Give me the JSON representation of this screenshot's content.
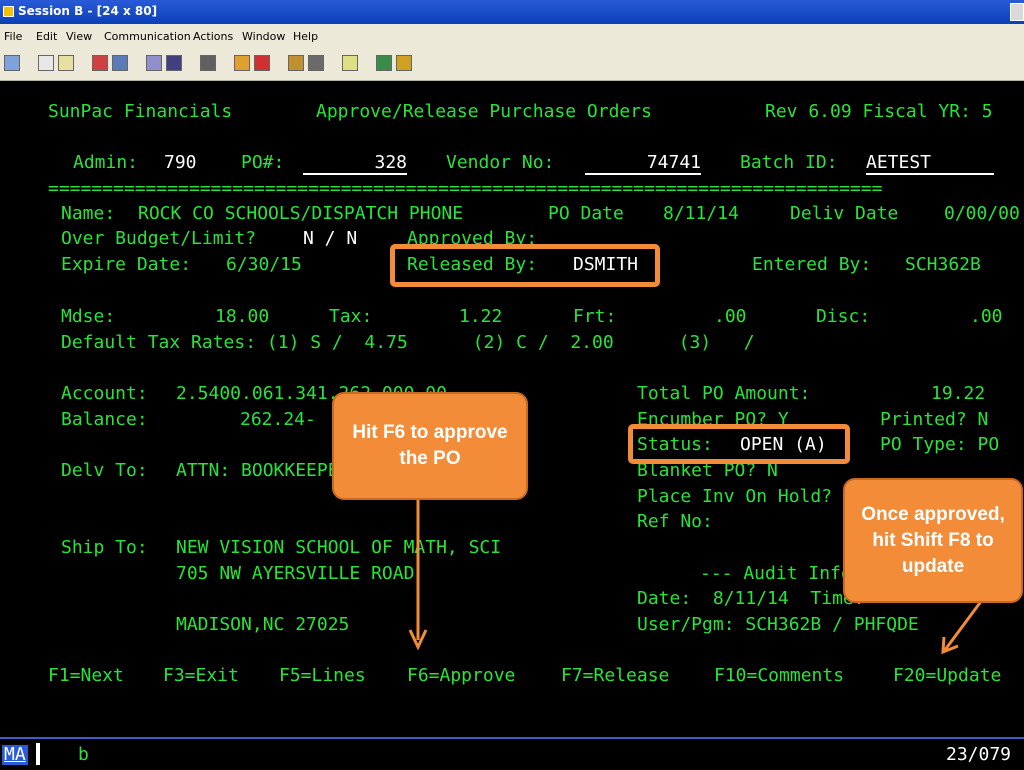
{
  "window": {
    "title": "Session B - [24 x 80]"
  },
  "menu": [
    "File",
    "Edit",
    "View",
    "Communication",
    "Actions",
    "Window",
    "Help"
  ],
  "terminal": {
    "header": {
      "company": "SunPac Financials",
      "screen_title": "Approve/Release Purchase Orders",
      "rev": "Rev 6.09 Fiscal YR: 5"
    },
    "keys": {
      "admin_label": "Admin:",
      "admin": "790",
      "po_label": "PO#:",
      "po": "328",
      "vendor_label": "Vendor No:",
      "vendor": "74741",
      "batch_label": "Batch ID:",
      "batch": "AETEST"
    },
    "separator": "=============================================================================",
    "name_label": "Name:",
    "name": "ROCK CO SCHOOLS/DISPATCH PHONE",
    "po_date_label": "PO Date",
    "po_date": "8/11/14",
    "deliv_date_label": "Deliv Date",
    "deliv_date": "0/00/00",
    "over_budget_label": "Over Budget/Limit?",
    "over_budget": "N / N",
    "approved_by_label": "Approved By:",
    "expire_label": "Expire Date:",
    "expire": "6/30/15",
    "released_by_label": "Released By:",
    "released_by": "DSMITH",
    "entered_by_label": "Entered By:",
    "entered_by": "SCH362B",
    "mdse_label": "Mdse:",
    "mdse": "18.00",
    "tax_label": "Tax:",
    "tax": "1.22",
    "frt_label": "Frt:",
    "frt": ".00",
    "disc_label": "Disc:",
    "disc": ".00",
    "tax_rates": "Default Tax Rates: (1) S /  4.75      (2) C /  2.00      (3)   /",
    "account_label": "Account:",
    "account": "2.5400.061.341.262.000.00",
    "balance_label": "Balance:",
    "balance": "262.24-",
    "total_label": "Total PO Amount:",
    "total": "19.22",
    "encumber": "Encumber PO? Y",
    "printed": "Printed? N",
    "status_label": "Status:",
    "status": "OPEN (A)",
    "po_type": "PO Type: PO",
    "delv_label": "Delv To:",
    "delv": "ATTN: BOOKKEEPER",
    "blanket": "Blanket PO? N",
    "place_inv": "Place Inv On Hold?",
    "ref_no": "Ref No:",
    "ship_label": "Ship To:",
    "ship1": "NEW VISION SCHOOL OF MATH, SCI",
    "ship2": "705 NW AYERSVILLE ROAD",
    "ship3": "MADISON,NC 27025",
    "audit": "--- Audit Info ---",
    "audit_date": "Date:  8/11/14  Time:",
    "audit_user": "User/Pgm: SCH362B / PHFQDE",
    "fkeys": {
      "f1": "F1=Next",
      "f3": "F3=Exit",
      "f5": "F5=Lines",
      "f6": "F6=Approve",
      "f7": "F7=Release",
      "f10": "F10=Comments",
      "f20": "F20=Update"
    }
  },
  "statusbar": {
    "mode": "MA",
    "indicator": "b",
    "cursor": "23/079"
  },
  "callouts": {
    "approve": "Hit F6 to approve the PO",
    "update": "Once approved, hit Shift F8 to update"
  },
  "colors": {
    "terminal_text": "#29e33a",
    "highlight": "#ffffff",
    "callout": "#f28c38"
  }
}
